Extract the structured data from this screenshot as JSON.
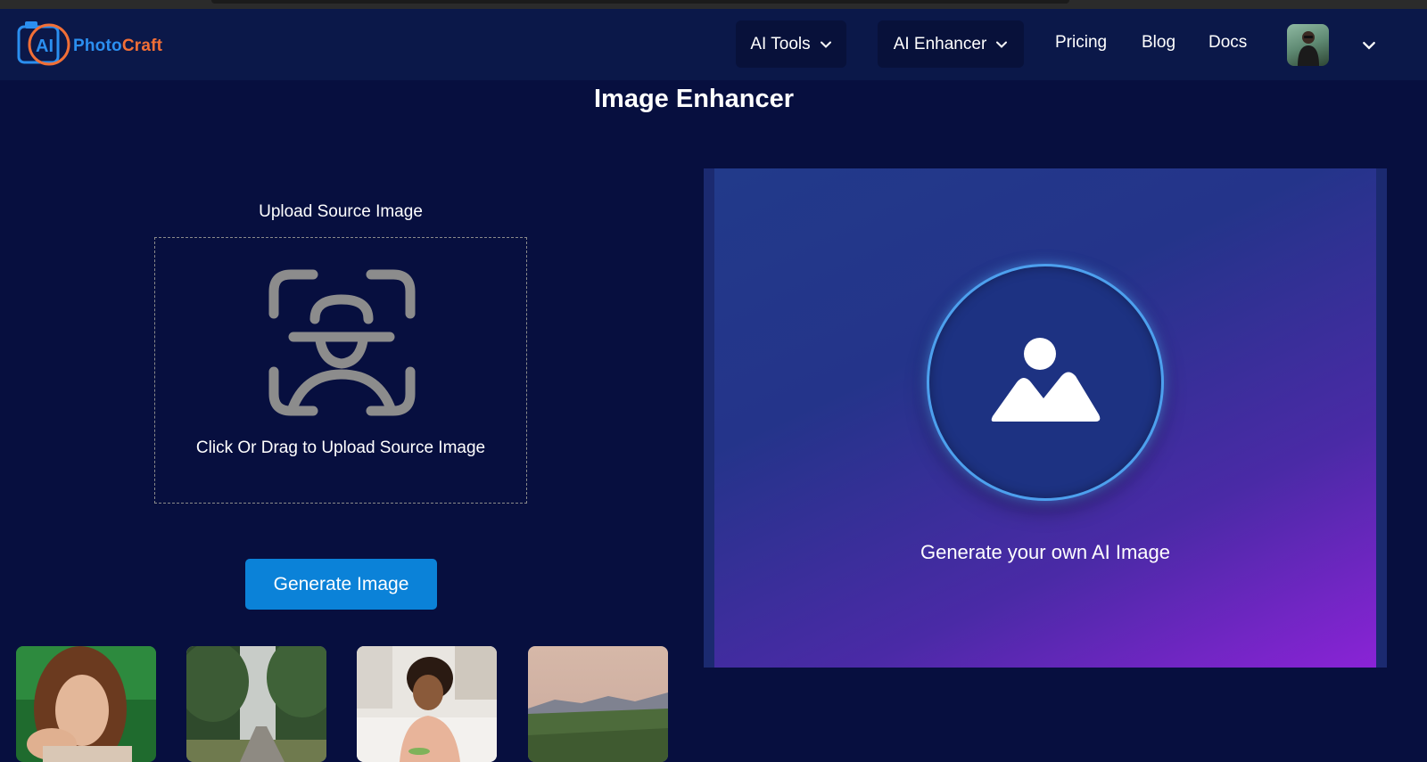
{
  "app": {
    "logo": {
      "ai": "AI",
      "word_part1": "Photo",
      "word_part2": "Craft"
    }
  },
  "nav": {
    "ai_tools": "AI Tools",
    "ai_enhancer": "AI Enhancer",
    "pricing": "Pricing",
    "blog": "Blog",
    "docs": "Docs",
    "avatar_icon": "user-avatar",
    "chevron_icon": "chevron-down-icon"
  },
  "page": {
    "title": "Image Enhancer"
  },
  "upload": {
    "label": "Upload Source Image",
    "hint": "Click Or Drag to Upload Source Image",
    "icon": "face-scan-icon"
  },
  "actions": {
    "generate": "Generate Image"
  },
  "samples": [
    {
      "name": "woman-portrait"
    },
    {
      "name": "forest-road"
    },
    {
      "name": "woman-kitchen"
    },
    {
      "name": "mountain-landscape"
    }
  ],
  "preview": {
    "caption": "Generate your own AI Image",
    "icon": "image-icon"
  },
  "colors": {
    "background": "#070f3f",
    "navbar": "#0b1849",
    "primary_button": "#0b82d8",
    "logo_blue": "#2b8ff0",
    "logo_orange": "#f26f36",
    "preview_gradient_end": "#8a23d6"
  }
}
